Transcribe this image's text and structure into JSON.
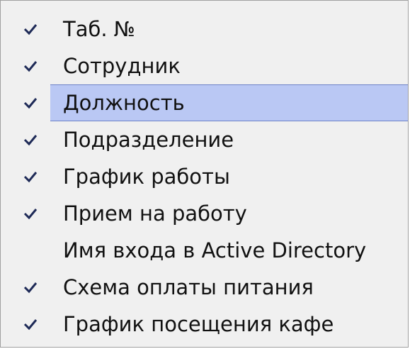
{
  "menu": {
    "items": [
      {
        "label": "Таб. №",
        "checked": true,
        "highlighted": false
      },
      {
        "label": "Сотрудник",
        "checked": true,
        "highlighted": false
      },
      {
        "label": "Должность",
        "checked": true,
        "highlighted": true
      },
      {
        "label": "Подразделение",
        "checked": true,
        "highlighted": false
      },
      {
        "label": "График работы",
        "checked": true,
        "highlighted": false
      },
      {
        "label": "Прием на работу",
        "checked": true,
        "highlighted": false
      },
      {
        "label": "Имя входа в Active Directory",
        "checked": false,
        "highlighted": false
      },
      {
        "label": "Схема оплаты питания",
        "checked": true,
        "highlighted": false
      },
      {
        "label": "График посещения кафе",
        "checked": true,
        "highlighted": false
      }
    ]
  },
  "colors": {
    "menu_bg": "#f0f0f0",
    "menu_border": "#a0a0a0",
    "check_bg": "#c5d2f5",
    "check_border": "#6f86c8",
    "highlight_bg": "#bac8f4",
    "highlight_border": "#6d82c8",
    "text": "#111111"
  }
}
